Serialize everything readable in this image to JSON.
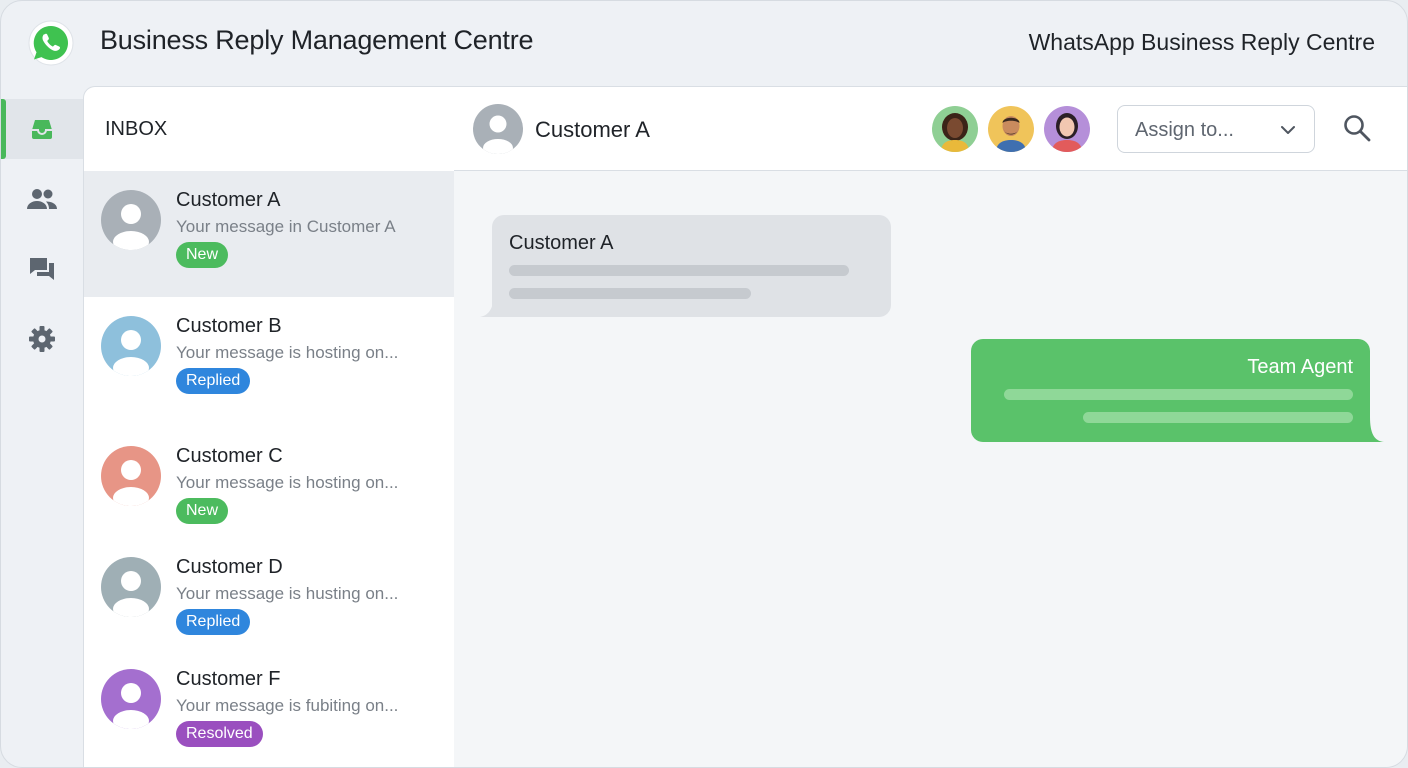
{
  "header": {
    "app_title": "Business Reply Management Centre",
    "right_title": "WhatsApp Business Reply Centre",
    "logo_icon": "whatsapp-logo-icon"
  },
  "rail": {
    "items": [
      {
        "icon": "inbox-icon",
        "active": true
      },
      {
        "icon": "contacts-icon",
        "active": false
      },
      {
        "icon": "chat-icon",
        "active": false
      },
      {
        "icon": "settings-icon",
        "active": false
      }
    ],
    "accent": "#49b85b"
  },
  "inbox": {
    "title": "INBOX",
    "conversations": [
      {
        "name": "Customer A",
        "preview": "Your message in Customer A",
        "status": "New",
        "status_color": "#4cbb5e",
        "avatar_color": "#a9b0b7",
        "selected": true
      },
      {
        "name": "Customer B",
        "preview": "Your message is hosting on...",
        "status": "Replied",
        "status_color": "#2f86dd",
        "avatar_color": "#8ec0dc",
        "selected": false
      },
      {
        "name": "Customer C",
        "preview": "Your message is hosting on...",
        "status": "New",
        "status_color": "#4cbb5e",
        "avatar_color": "#e79586",
        "selected": false
      },
      {
        "name": "Customer D",
        "preview": "Your message is husting on...",
        "status": "Replied",
        "status_color": "#2f86dd",
        "avatar_color": "#9fafb5",
        "selected": false
      },
      {
        "name": "Customer F",
        "preview": "Your message is fubiting on...",
        "status": "Resolved",
        "status_color": "#9a4fbf",
        "avatar_color": "#a46fcf",
        "selected": false
      }
    ]
  },
  "chat": {
    "contact_name": "Customer A",
    "assign_placeholder": "Assign to...",
    "agents": [
      {
        "name": "agent-1",
        "bg": "#8fcf94"
      },
      {
        "name": "agent-2",
        "bg": "#f0c45a"
      },
      {
        "name": "agent-3",
        "bg": "#b58fd9"
      }
    ],
    "messages": [
      {
        "direction": "incoming",
        "sender": "Customer A",
        "color": "#dfe2e6"
      },
      {
        "direction": "outgoing",
        "sender": "Team Agent",
        "color": "#5ac26a"
      }
    ]
  }
}
